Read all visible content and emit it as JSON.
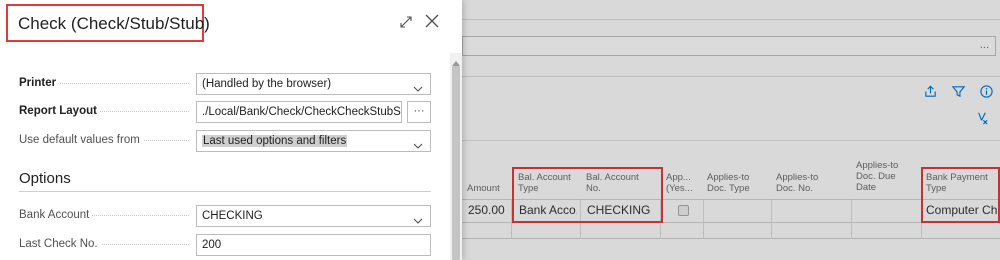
{
  "dialog": {
    "title": "Check (Check/Stub/Stub)",
    "fields": {
      "printer": {
        "label": "Printer",
        "value": "(Handled by the browser)"
      },
      "report_layout": {
        "label": "Report Layout",
        "value": "./Local/Bank/Check/CheckCheckStubStu...",
        "lookup": "···"
      },
      "use_default": {
        "label": "Use default values from",
        "value": "Last used options and filters"
      }
    },
    "options": {
      "heading": "Options",
      "bank_account": {
        "label": "Bank Account",
        "value": "CHECKING"
      },
      "last_check_no": {
        "label": "Last Check No.",
        "value": "200"
      }
    }
  },
  "background": {
    "field_ellipsis": "...",
    "columns": [
      {
        "key": "amount",
        "header": "Amount"
      },
      {
        "key": "bal_account_type",
        "header": "Bal. Account Type"
      },
      {
        "key": "bal_account_no",
        "header": "Bal. Account No."
      },
      {
        "key": "applies_yes",
        "header": "App... (Yes..."
      },
      {
        "key": "applies_to_doc_type",
        "header": "Applies-to Doc. Type"
      },
      {
        "key": "applies_to_doc_no",
        "header": "Applies-to Doc. No."
      },
      {
        "key": "applies_to_doc_due_date",
        "header": "Applies-to Doc. Due Date"
      },
      {
        "key": "bank_payment_type",
        "header": "Bank Payment Type"
      }
    ],
    "row": {
      "amount": "250.00",
      "bal_account_type": "Bank Acco...",
      "bal_account_no": "CHECKING",
      "bank_payment_type": "Computer Ch..."
    }
  },
  "colors": {
    "highlight_box": "#e03b3b",
    "accent": "#0078d4"
  }
}
